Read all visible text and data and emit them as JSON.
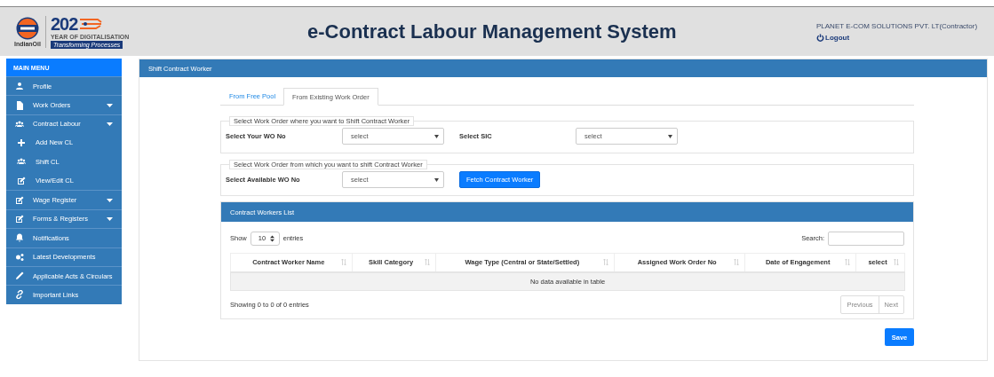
{
  "header": {
    "logo": {
      "brand": "IndianOil",
      "year": "202",
      "tagline": "YEAR OF DIGITALISATION",
      "motto": "Transforming Processes"
    },
    "title": "e-Contract Labour Management System",
    "user": "PLANET E-COM SOLUTIONS PVT. LT(Contractor)",
    "logout": "Logout"
  },
  "sidebar": {
    "heading": "MAIN MENU",
    "items": [
      {
        "label": "Profile",
        "kind": "link"
      },
      {
        "label": "Work Orders",
        "kind": "dropdown"
      },
      {
        "label": "Contract Labour",
        "kind": "dropdown"
      },
      {
        "label": "Add New CL",
        "kind": "subitem"
      },
      {
        "label": "Shift CL",
        "kind": "subitem"
      },
      {
        "label": "View/Edit CL",
        "kind": "subitem"
      },
      {
        "label": "Wage Register",
        "kind": "dropdown"
      },
      {
        "label": "Forms & Registers",
        "kind": "dropdown"
      },
      {
        "label": "Notifications",
        "kind": "link"
      },
      {
        "label": "Latest Developments",
        "kind": "link"
      },
      {
        "label": "Applicable Acts & Circulars",
        "kind": "link"
      },
      {
        "label": "Important Links",
        "kind": "link"
      }
    ]
  },
  "panel": {
    "title": "Shift Contract Worker",
    "tabs": [
      {
        "label": "From Free Pool",
        "selected": false
      },
      {
        "label": "From Existing Work Order",
        "selected": true
      }
    ],
    "target_group": {
      "legend": "Select Work Order where you want to Shift Contract Worker",
      "fields": [
        {
          "label": "Select Your WO No",
          "value": "select"
        },
        {
          "label": "Select SIC",
          "value": "select"
        }
      ]
    },
    "source_group": {
      "legend": "Select Work Order from which you want to shift Contract Worker",
      "fields": [
        {
          "label": "Select Available WO No",
          "value": "select"
        }
      ],
      "button": "Fetch Contract Worker"
    },
    "list": {
      "title": "Contract Workers List",
      "show_label": "Show",
      "page_size": "10",
      "entries_label": "entries",
      "search_label": "Search:",
      "columns": [
        "Contract Worker Name",
        "Skill Category",
        "Wage Type (Central or State/Settled)",
        "Assigned Work Order No",
        "Date of Engagement",
        "select"
      ],
      "empty_message": "No data available in table",
      "info": "Showing 0 to 0 of 0 entries",
      "pager": [
        "Previous",
        "Next"
      ]
    },
    "save": "Save"
  }
}
